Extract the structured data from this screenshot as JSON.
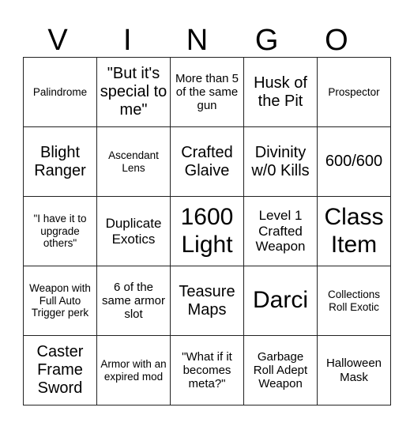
{
  "header": {
    "letters": [
      "V",
      "I",
      "N",
      "G",
      "O"
    ]
  },
  "board": {
    "rows": [
      [
        {
          "text": "Palindrome",
          "size": "xs"
        },
        {
          "text": "\"But it's special to me\"",
          "size": "lg"
        },
        {
          "text": "More than 5 of the same gun",
          "size": "sm"
        },
        {
          "text": "Husk of the Pit",
          "size": "lg"
        },
        {
          "text": "Prospector",
          "size": "xs"
        }
      ],
      [
        {
          "text": "Blight Ranger",
          "size": "lg"
        },
        {
          "text": "Ascendant Lens",
          "size": "xs"
        },
        {
          "text": "Crafted Glaive",
          "size": "lg"
        },
        {
          "text": "Divinity w/0 Kills",
          "size": "lg"
        },
        {
          "text": "600/600",
          "size": "lg"
        }
      ],
      [
        {
          "text": "\"I have it to upgrade others\"",
          "size": "xs"
        },
        {
          "text": "Duplicate Exotics",
          "size": "md"
        },
        {
          "text": "1600 Light",
          "size": "xxl"
        },
        {
          "text": "Level 1 Crafted Weapon",
          "size": "md"
        },
        {
          "text": "Class Item",
          "size": "xxl"
        }
      ],
      [
        {
          "text": "Weapon with Full Auto Trigger perk",
          "size": "xs"
        },
        {
          "text": "6 of the same armor slot",
          "size": "sm"
        },
        {
          "text": "Teasure Maps",
          "size": "lg"
        },
        {
          "text": "Darci",
          "size": "xxl"
        },
        {
          "text": "Collections Roll Exotic",
          "size": "xs"
        }
      ],
      [
        {
          "text": "Caster Frame Sword",
          "size": "lg"
        },
        {
          "text": "Armor with an expired mod",
          "size": "xs"
        },
        {
          "text": "\"What if it becomes meta?\"",
          "size": "sm"
        },
        {
          "text": "Garbage Roll Adept Weapon",
          "size": "sm"
        },
        {
          "text": "Halloween Mask",
          "size": "sm"
        }
      ]
    ]
  }
}
